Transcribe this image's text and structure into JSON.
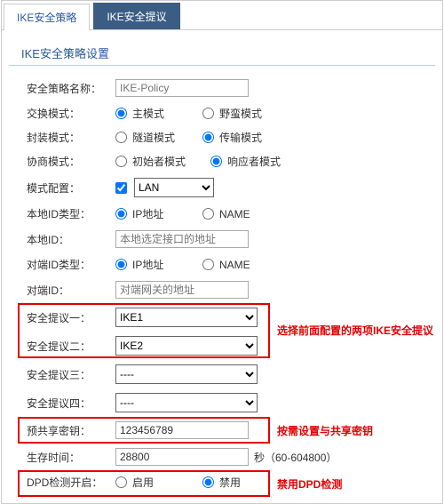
{
  "tabs": {
    "active": "IKE安全策略",
    "inactive": "IKE安全提议"
  },
  "section_title": "IKE安全策略设置",
  "rows": {
    "policy_name": {
      "label": "安全策略名称：",
      "placeholder": "IKE-Policy"
    },
    "exchange_mode": {
      "label": "交换模式：",
      "opt1": "主模式",
      "opt2": "野蛮模式"
    },
    "encap_mode": {
      "label": "封装模式：",
      "opt1": "隧道模式",
      "opt2": "传输模式"
    },
    "nego_mode": {
      "label": "协商模式：",
      "opt1": "初始者模式",
      "opt2": "响应者模式"
    },
    "mode_config": {
      "label": "模式配置：",
      "select_value": "LAN"
    },
    "local_id_type": {
      "label": "本地ID类型：",
      "opt1": "IP地址",
      "opt2": "NAME"
    },
    "local_id": {
      "label": "本地ID：",
      "placeholder": "本地选定接口的地址"
    },
    "peer_id_type": {
      "label": "对端ID类型：",
      "opt1": "IP地址",
      "opt2": "NAME"
    },
    "peer_id": {
      "label": "对端ID：",
      "placeholder": "对端网关的地址"
    },
    "proposal1": {
      "label": "安全提议一：",
      "value": "IKE1"
    },
    "proposal2": {
      "label": "安全提议二：",
      "value": "IKE2"
    },
    "proposal3": {
      "label": "安全提议三：",
      "value": "----"
    },
    "proposal4": {
      "label": "安全提议四：",
      "value": "----"
    },
    "psk": {
      "label": "预共享密钥：",
      "value": "123456789"
    },
    "lifetime": {
      "label": "生存时间：",
      "value": "28800",
      "suffix": "秒（60-604800）"
    },
    "dpd": {
      "label": "DPD检测开启：",
      "opt1": "启用",
      "opt2": "禁用"
    }
  },
  "annotations": {
    "proposal": "选择前面配置的两项IKE安全提议",
    "psk": "按需设置与共享密钥",
    "dpd": "禁用DPD检测"
  }
}
